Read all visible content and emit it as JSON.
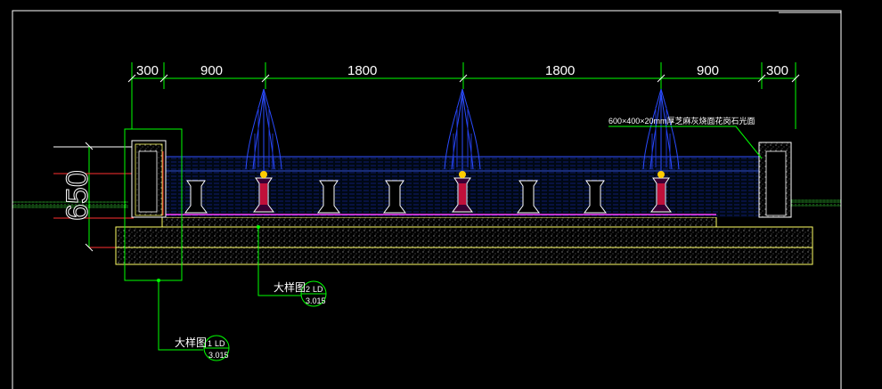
{
  "dimensions": {
    "top": [
      "300",
      "900",
      "1800",
      "1800",
      "900",
      "300"
    ],
    "vertical": "650"
  },
  "material_note": "600×400×20mm厚芝麻灰烧面花岗石光面",
  "callouts": [
    {
      "label": "大样图",
      "number": "2",
      "code": "LD",
      "sheet": "3.015"
    },
    {
      "label": "大样图",
      "number": "1",
      "code": "LD",
      "sheet": "3.015"
    }
  ],
  "colors": {
    "background": "#000000",
    "dimension": "#00ff00",
    "water_spray": "#1f3fff",
    "wall": "#ffffff",
    "base": "#ffff66",
    "leader": "#00ff00"
  }
}
